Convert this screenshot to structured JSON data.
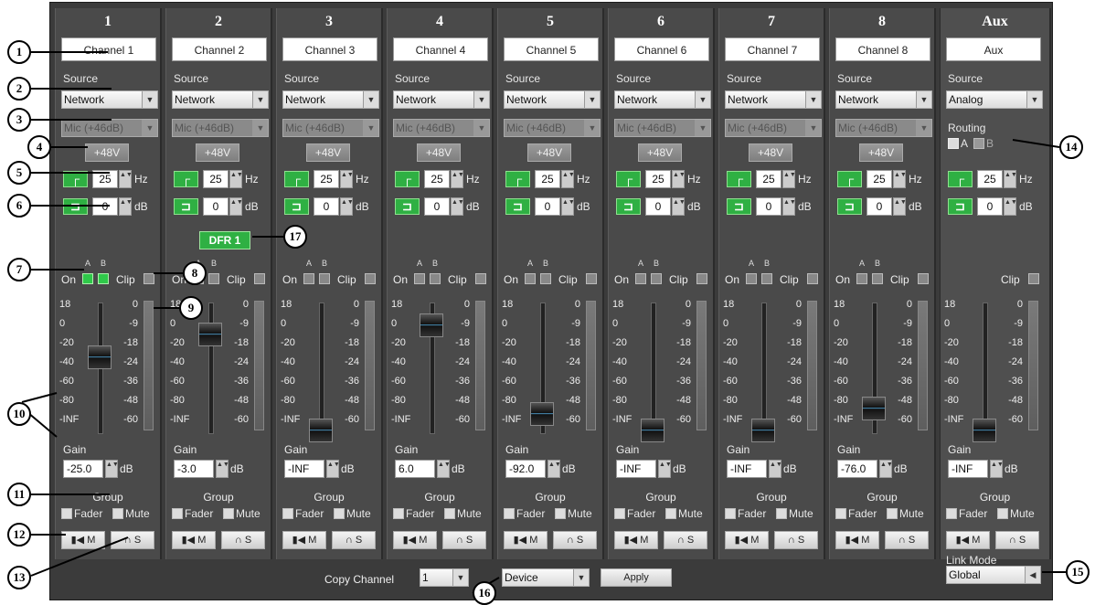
{
  "channels": [
    {
      "num": "1",
      "name": "Channel 1",
      "source": "Network",
      "input": "Mic (+46dB)",
      "phantom": "+48V",
      "hpf": "25",
      "hpf_unit": "Hz",
      "eq": "0",
      "eq_unit": "dB",
      "gain": "-25.0",
      "gain_db": -25,
      "scale_left": [
        "18",
        "0",
        "-20",
        "-40",
        "-60",
        "-80",
        "-INF"
      ],
      "scale_right": [
        "0",
        "-9",
        "-18",
        "-24",
        "-36",
        "-48",
        "-60"
      ],
      "a_on": true,
      "b_on": true
    },
    {
      "num": "2",
      "name": "Channel 2",
      "source": "Network",
      "input": "Mic (+46dB)",
      "phantom": "+48V",
      "hpf": "25",
      "hpf_unit": "Hz",
      "eq": "0",
      "eq_unit": "dB",
      "gain": "-3.0",
      "gain_db": -3,
      "scale_left": [
        "18",
        "0",
        "-20",
        "-40",
        "-60",
        "-80",
        "-INF"
      ],
      "scale_right": [
        "0",
        "-9",
        "-18",
        "-24",
        "-36",
        "-48",
        "-60"
      ],
      "a_on": false,
      "b_on": false,
      "dfr": "DFR 1"
    },
    {
      "num": "3",
      "name": "Channel 3",
      "source": "Network",
      "input": "Mic (+46dB)",
      "phantom": "+48V",
      "hpf": "25",
      "hpf_unit": "Hz",
      "eq": "0",
      "eq_unit": "dB",
      "gain": "-INF",
      "gain_db": -200,
      "scale_left": [
        "18",
        "0",
        "-20",
        "-40",
        "-60",
        "-80",
        "-INF"
      ],
      "scale_right": [
        "0",
        "-9",
        "-18",
        "-24",
        "-36",
        "-48",
        "-60"
      ],
      "a_on": false,
      "b_on": false
    },
    {
      "num": "4",
      "name": "Channel 4",
      "source": "Network",
      "input": "Mic (+46dB)",
      "phantom": "+48V",
      "hpf": "25",
      "hpf_unit": "Hz",
      "eq": "0",
      "eq_unit": "dB",
      "gain": "6.0",
      "gain_db": 6,
      "scale_left": [
        "18",
        "0",
        "-20",
        "-40",
        "-60",
        "-80",
        "-INF"
      ],
      "scale_right": [
        "0",
        "-9",
        "-18",
        "-24",
        "-36",
        "-48",
        "-60"
      ],
      "a_on": false,
      "b_on": false
    },
    {
      "num": "5",
      "name": "Channel 5",
      "source": "Network",
      "input": "Mic (+46dB)",
      "phantom": "+48V",
      "hpf": "25",
      "hpf_unit": "Hz",
      "eq": "0",
      "eq_unit": "dB",
      "gain": "-92.0",
      "gain_db": -92,
      "scale_left": [
        "18",
        "0",
        "-20",
        "-40",
        "-60",
        "-80",
        "-INF"
      ],
      "scale_right": [
        "0",
        "-9",
        "-18",
        "-24",
        "-36",
        "-48",
        "-60"
      ],
      "a_on": false,
      "b_on": false
    },
    {
      "num": "6",
      "name": "Channel 6",
      "source": "Network",
      "input": "Mic (+46dB)",
      "phantom": "+48V",
      "hpf": "25",
      "hpf_unit": "Hz",
      "eq": "0",
      "eq_unit": "dB",
      "gain": "-INF",
      "gain_db": -200,
      "scale_left": [
        "18",
        "0",
        "-20",
        "-40",
        "-60",
        "-80",
        "-INF"
      ],
      "scale_right": [
        "0",
        "-9",
        "-18",
        "-24",
        "-36",
        "-48",
        "-60"
      ],
      "a_on": false,
      "b_on": false
    },
    {
      "num": "7",
      "name": "Channel 7",
      "source": "Network",
      "input": "Mic (+46dB)",
      "phantom": "+48V",
      "hpf": "25",
      "hpf_unit": "Hz",
      "eq": "0",
      "eq_unit": "dB",
      "gain": "-INF",
      "gain_db": -200,
      "scale_left": [
        "18",
        "0",
        "-20",
        "-40",
        "-60",
        "-80",
        "-INF"
      ],
      "scale_right": [
        "0",
        "-9",
        "-18",
        "-24",
        "-36",
        "-48",
        "-60"
      ],
      "a_on": false,
      "b_on": false
    },
    {
      "num": "8",
      "name": "Channel 8",
      "source": "Network",
      "input": "Mic (+46dB)",
      "phantom": "+48V",
      "hpf": "25",
      "hpf_unit": "Hz",
      "eq": "0",
      "eq_unit": "dB",
      "gain": "-76.0",
      "gain_db": -76,
      "scale_left": [
        "18",
        "0",
        "-20",
        "-40",
        "-60",
        "-80",
        "-INF"
      ],
      "scale_right": [
        "0",
        "-9",
        "-18",
        "-24",
        "-36",
        "-48",
        "-60"
      ],
      "a_on": false,
      "b_on": false
    }
  ],
  "aux": {
    "num": "Aux",
    "name": "Aux",
    "source": "Analog",
    "routing_label": "Routing",
    "route_a": "A",
    "route_b": "B",
    "hpf": "25",
    "hpf_unit": "Hz",
    "eq": "0",
    "eq_unit": "dB",
    "gain": "-INF",
    "gain_db": -200,
    "scale_left": [
      "18",
      "0",
      "-20",
      "-40",
      "-60",
      "-80",
      "-INF"
    ],
    "scale_right": [
      "0",
      "-9",
      "-18",
      "-24",
      "-36",
      "-48",
      "-60"
    ],
    "link_mode_label": "Link Mode",
    "link_mode": "Global"
  },
  "labels": {
    "source": "Source",
    "on": "On",
    "clip": "Clip",
    "a": "A",
    "b": "B",
    "gain": "Gain",
    "db": "dB",
    "group": "Group",
    "fader": "Fader",
    "mute": "Mute",
    "m": "M",
    "s": "S"
  },
  "bottom": {
    "copy_channel": "Copy Channel",
    "copy_value": "1",
    "device": "Device",
    "apply": "Apply"
  },
  "callouts": [
    "1",
    "2",
    "3",
    "4",
    "5",
    "6",
    "7",
    "8",
    "9",
    "10",
    "11",
    "12",
    "13",
    "14",
    "15",
    "16",
    "17"
  ],
  "colors": {
    "green": "#2fb043",
    "panel": "#4a4a4a",
    "bg": "#3b3b3b"
  }
}
